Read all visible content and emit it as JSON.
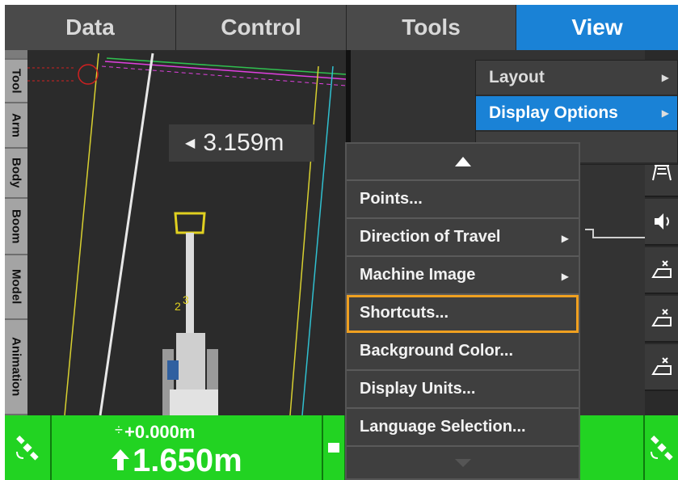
{
  "tabs": [
    {
      "label": "Data",
      "active": false
    },
    {
      "label": "Control",
      "active": false
    },
    {
      "label": "Tools",
      "active": false
    },
    {
      "label": "View",
      "active": true
    }
  ],
  "side_tabs": [
    "Tool",
    "Arm",
    "Body",
    "Boom",
    "Model",
    "Animation"
  ],
  "map": {
    "distance_label": "3.159m",
    "colors": {
      "guide_line": "#d8d030",
      "edge_line": "#e8e8e8",
      "boundary": "#30c0d0",
      "accent": "#e040e0"
    }
  },
  "status": {
    "height_delta": "+0.000m",
    "height_value": "1.650m",
    "background_color": "#22d322"
  },
  "view_menu": {
    "items": [
      {
        "label": "Layout",
        "has_submenu": true,
        "active": false
      },
      {
        "label": "Display Options",
        "has_submenu": true,
        "active": true
      }
    ]
  },
  "display_options_menu": {
    "items": [
      {
        "label": "Points...",
        "has_submenu": false
      },
      {
        "label": "Direction of Travel",
        "has_submenu": true
      },
      {
        "label": "Machine Image",
        "has_submenu": true
      },
      {
        "label": "Shortcuts...",
        "has_submenu": false,
        "highlighted": true
      },
      {
        "label": "Background Color...",
        "has_submenu": false
      },
      {
        "label": "Display Units...",
        "has_submenu": false
      },
      {
        "label": "Language Selection...",
        "has_submenu": false
      }
    ],
    "highlight_color": "#f0a020"
  },
  "right_toolbar_icons": [
    "light-tower-icon",
    "speaker-icon",
    "target-edit-icon",
    "target-edit-icon",
    "target-edit-icon"
  ],
  "accent_color": "#1a82d6"
}
